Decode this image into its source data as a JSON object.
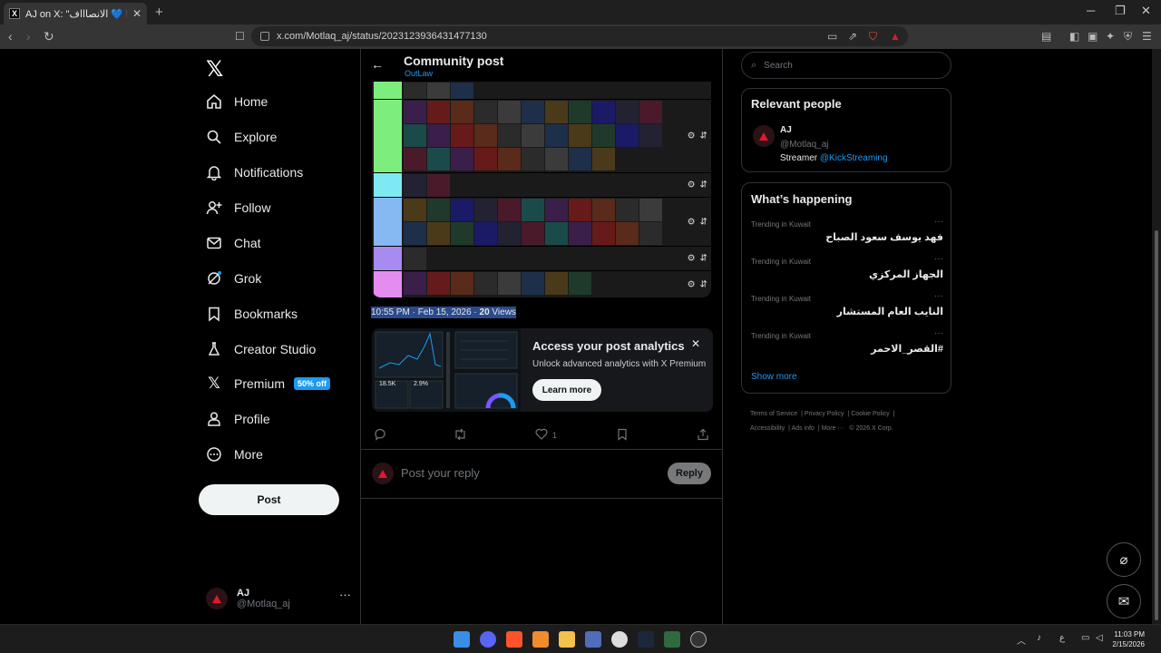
{
  "browser": {
    "tab_title": "AJ on X: \"الانصاااف 💙 https://t...",
    "tab_icon": "X",
    "url": "x.com/Motlaq_aj/status/2023123936431477130"
  },
  "nav": {
    "items": [
      {
        "label": "Home",
        "icon": "home-icon"
      },
      {
        "label": "Explore",
        "icon": "search-icon"
      },
      {
        "label": "Notifications",
        "icon": "bell-icon"
      },
      {
        "label": "Follow",
        "icon": "person-add-icon"
      },
      {
        "label": "Chat",
        "icon": "mail-icon"
      },
      {
        "label": "Grok",
        "icon": "grok-icon"
      },
      {
        "label": "Bookmarks",
        "icon": "bookmark-icon"
      },
      {
        "label": "Creator Studio",
        "icon": "flask-icon"
      },
      {
        "label": "Premium",
        "icon": "x-icon",
        "badge": "50% off"
      },
      {
        "label": "Profile",
        "icon": "person-icon"
      },
      {
        "label": "More",
        "icon": "more-circle-icon"
      }
    ],
    "post_label": "Post",
    "account": {
      "name": "AJ",
      "handle": "@Motlaq_aj"
    }
  },
  "header": {
    "title": "Community post",
    "subtitle": "OutLaw"
  },
  "post": {
    "time": "10:55 PM · Feb 15, 2026 · ",
    "views_count": "20",
    "views_label": " Views",
    "like_count": "1"
  },
  "promo": {
    "title": "Access your post analytics",
    "subtitle": "Unlock advanced analytics with X Premium",
    "button": "Learn more",
    "stat1": "18.5K",
    "stat2": "2.9%"
  },
  "reply": {
    "placeholder": "Post your reply",
    "button": "Reply"
  },
  "right": {
    "search_placeholder": "Search",
    "relevant_title": "Relevant people",
    "person": {
      "name": "AJ",
      "handle": "@Motlaq_aj",
      "bio": "Streamer ",
      "bio_link": "@KickStreaming"
    },
    "happening_title": "What’s happening",
    "trends": [
      {
        "context": "Trending in Kuwait",
        "name": "فهد يوسف سعود الصباح"
      },
      {
        "context": "Trending in Kuwait",
        "name": "الجهاز المركزي"
      },
      {
        "context": "Trending in Kuwait",
        "name": "النايب العام المستشار"
      },
      {
        "context": "Trending in Kuwait",
        "name": "#القصر_الاحمر"
      }
    ],
    "show_more": "Show more",
    "footer": [
      "Terms of Service",
      "Privacy Policy",
      "Cookie Policy",
      "Accessibility",
      "Ads info",
      "More ···",
      "© 2026 X Corp."
    ]
  },
  "taskbar": {
    "time": "11:03 PM",
    "date": "2/15/2026"
  },
  "colors": {
    "accent": "#1d9bf0",
    "tier_colors": [
      "#7dee7d",
      "#7dee7d",
      "#7fe9f2",
      "#86b8f2",
      "#a78bf0",
      "#e58cf0"
    ]
  }
}
